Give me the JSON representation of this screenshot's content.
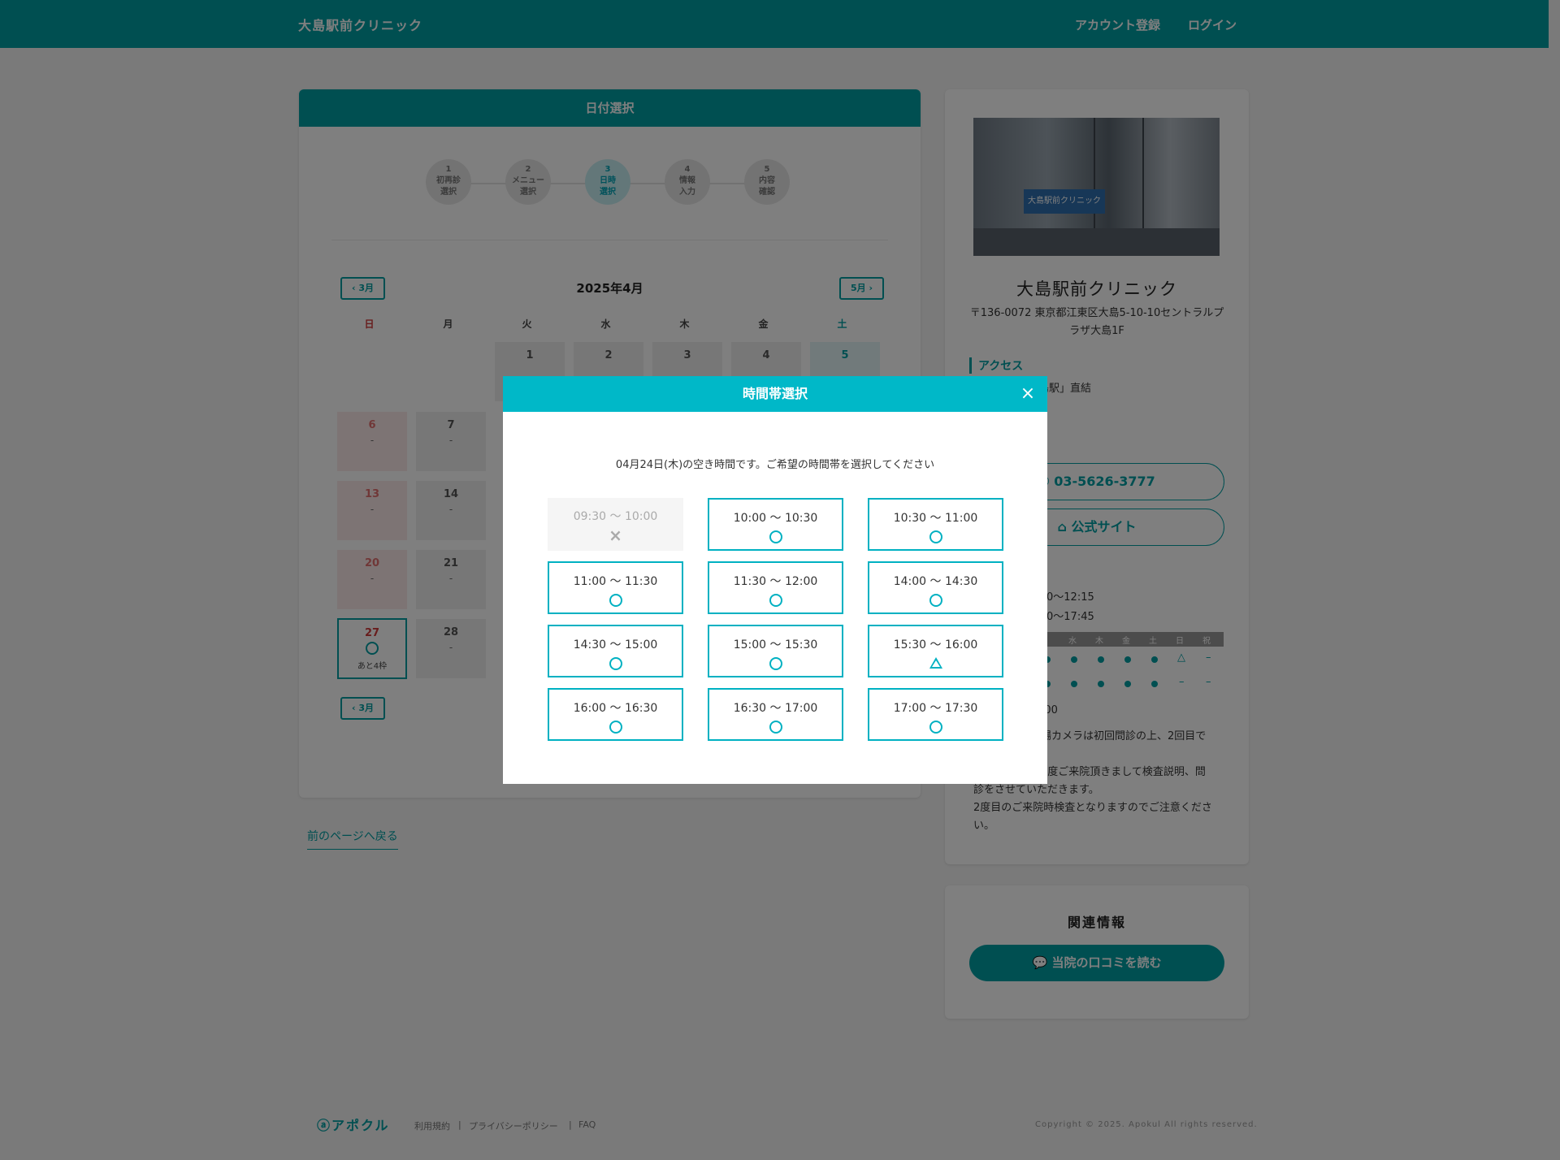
{
  "header": {
    "clinic_name": "大島駅前クリニック",
    "register": "アカウント登録",
    "login": "ログイン"
  },
  "main": {
    "card_title": "日付選択",
    "steps": [
      {
        "num": "1",
        "label1": "初再診",
        "label2": "選択"
      },
      {
        "num": "2",
        "label1": "メニュー",
        "label2": "選択"
      },
      {
        "num": "3",
        "label1": "日時",
        "label2": "選択"
      },
      {
        "num": "4",
        "label1": "情報",
        "label2": "入力"
      },
      {
        "num": "5",
        "label1": "内容",
        "label2": "確認"
      }
    ],
    "prev_month": "‹ 3月",
    "next_month": "5月 ›",
    "month_title": "2025年4月",
    "weekdays": [
      "日",
      "月",
      "火",
      "水",
      "木",
      "金",
      "土"
    ],
    "week1": [
      "1",
      "2",
      "3",
      "4",
      "5"
    ],
    "day_6": "6",
    "day_7": "7",
    "day_13": "13",
    "day_14": "14",
    "day_20": "20",
    "day_21": "21",
    "day_27": "27",
    "day_28": "28",
    "dash": "-",
    "day_27_remaining": "あと4枠",
    "bottom_prev": "‹ 3月",
    "back_link": "前のページへ戻る"
  },
  "side": {
    "photo_sign": "大島駅前クリニック",
    "name": "大島駅前クリニック",
    "address": "〒136-0072 東京都江東区大島5-10-10セントラルプラザ大島1F",
    "access_label": "アクセス",
    "access_text": "島駅」直結",
    "phone": "03-5626-3777",
    "official_site": "公式サイト",
    "hours_am": "0〜12:15",
    "hours_pm": "0〜17:45",
    "table_days": [
      "水",
      "木",
      "金",
      "土",
      "日",
      "祝"
    ],
    "closed_note": ":00",
    "notes": [
      "腸カメラは初回問診の上、2回目で",
      "。",
      "1度ご来院頂きまして検査説明、問",
      "診をさせていただきます。",
      "2度目のご来院時検査となりますのでご注意くださ",
      "い。"
    ],
    "dash": "–"
  },
  "related": {
    "title": "関連情報",
    "reviews": "当院の口コミを読む"
  },
  "footer": {
    "logo": "アポクル",
    "terms": "利用規約",
    "privacy": "プライバシーポリシー",
    "faq": "FAQ",
    "sep": "|",
    "copyright": "Copyright © 2025. Apokul All rights reserved."
  },
  "modal": {
    "title": "時間帯選択",
    "close": "×",
    "message": "04月24日(木)の空き時間です。ご希望の時間帯を選択してください",
    "slots": [
      {
        "time": "09:30 〜 10:00",
        "status": "×"
      },
      {
        "time": "10:00 〜 10:30",
        "status": "○"
      },
      {
        "time": "10:30 〜 11:00",
        "status": "○"
      },
      {
        "time": "11:00 〜 11:30",
        "status": "○"
      },
      {
        "time": "11:30 〜 12:00",
        "status": "○"
      },
      {
        "time": "14:00 〜 14:30",
        "status": "○"
      },
      {
        "time": "14:30 〜 15:00",
        "status": "○"
      },
      {
        "time": "15:00 〜 15:30",
        "status": "○"
      },
      {
        "time": "15:30 〜 16:00",
        "status": "△"
      },
      {
        "time": "16:00 〜 16:30",
        "status": "○"
      },
      {
        "time": "16:30 〜 17:00",
        "status": "○"
      },
      {
        "time": "17:00 〜 17:30",
        "status": "○"
      }
    ]
  },
  "colors": {
    "brand": "#009ea3",
    "modal_header": "#00b8c8"
  }
}
